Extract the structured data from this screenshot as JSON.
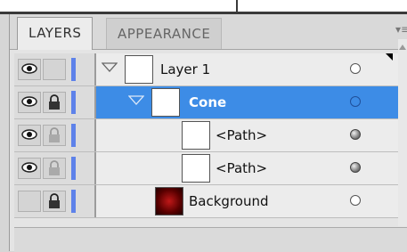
{
  "tabs": [
    {
      "label": "LAYERS",
      "active": true
    },
    {
      "label": "APPEARANCE",
      "active": false
    }
  ],
  "menu_icon": "panel-menu-icon",
  "layers": [
    {
      "name": "Layer 1",
      "visible": true,
      "locked": false,
      "expanded": true,
      "indent": 0,
      "selected": false,
      "target": "hollow",
      "thumb": "white"
    },
    {
      "name": "Cone",
      "visible": true,
      "locked": true,
      "expanded": true,
      "indent": 1,
      "selected": true,
      "target": "hollow",
      "thumb": "white"
    },
    {
      "name": "<Path>",
      "visible": true,
      "locked": true,
      "expanded": false,
      "indent": 2,
      "selected": false,
      "target": "filled",
      "thumb": "white"
    },
    {
      "name": "<Path>",
      "visible": true,
      "locked": true,
      "expanded": false,
      "indent": 2,
      "selected": false,
      "target": "filled",
      "thumb": "white"
    },
    {
      "name": "Background",
      "visible": false,
      "locked": true,
      "expanded": false,
      "indent": 1,
      "selected": false,
      "target": "hollow",
      "thumb": "dark-red"
    }
  ],
  "colors": {
    "selection": "#3d8ce6",
    "layer_color": "#5e82ea"
  }
}
